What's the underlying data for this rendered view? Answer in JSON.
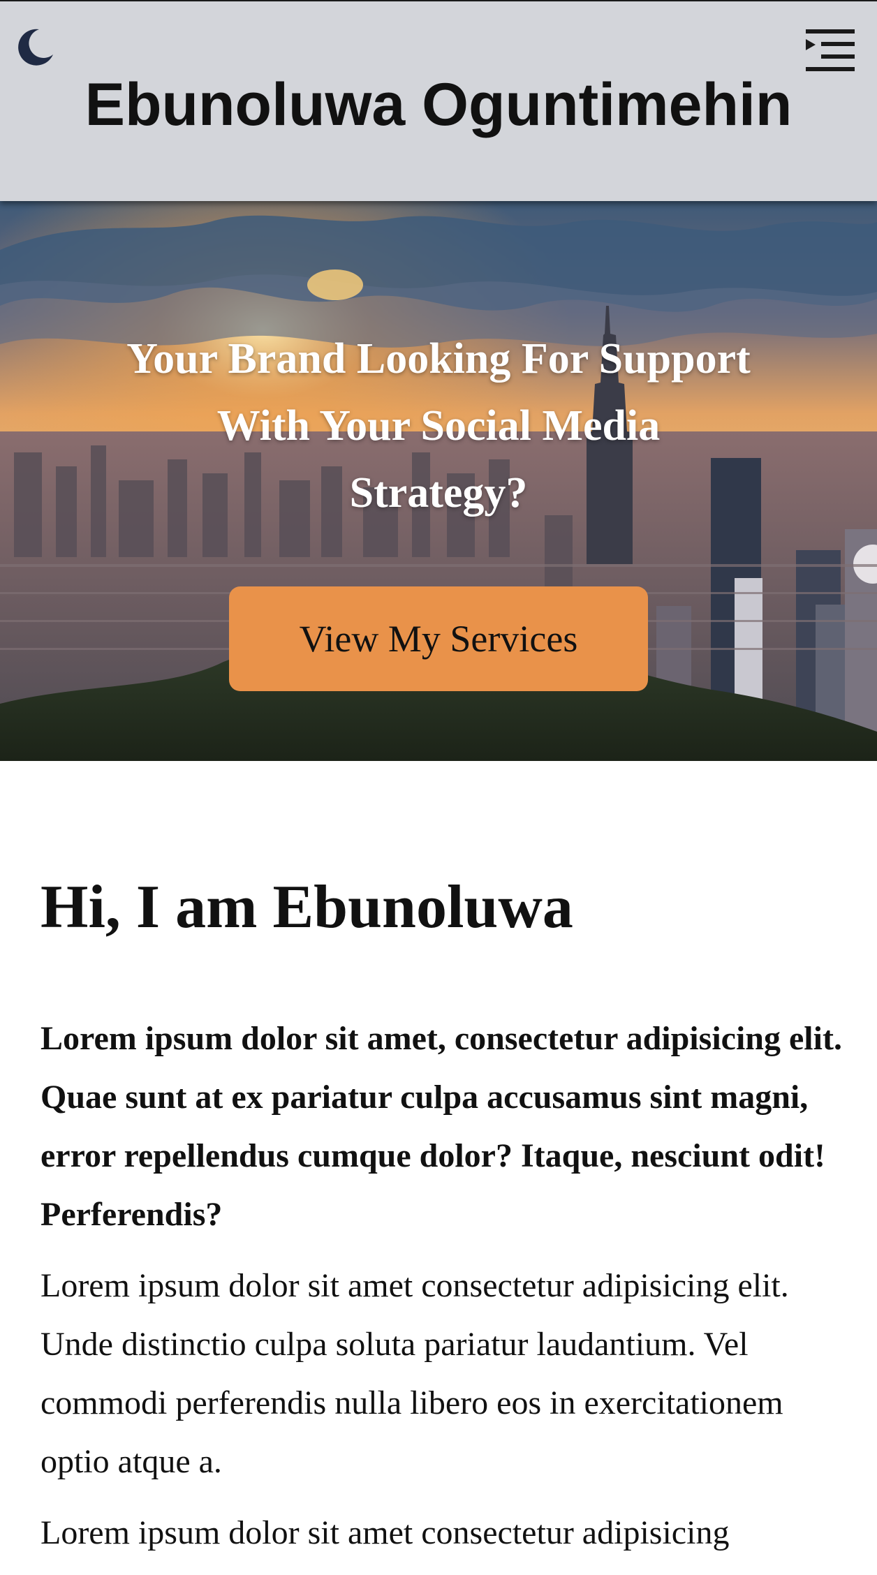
{
  "header": {
    "theme_toggle_icon": "moon-icon",
    "menu_icon": "menu-indent-icon",
    "site_title": "Ebunoluwa Oguntimehin"
  },
  "hero": {
    "heading": "Your Brand Looking For Support With Your Social Media Strategy?",
    "cta_label": "View My Services",
    "cta_color": "#e9924a"
  },
  "about": {
    "heading": "Hi, I am Ebunoluwa",
    "lead": "Lorem ipsum dolor sit amet, consectetur adipisicing elit. Quae sunt at ex pariatur culpa accusamus sint magni, error repellendus cumque dolor? Itaque, nesciunt odit! Perferendis?",
    "paragraph_1": "Lorem ipsum dolor sit amet consectetur adipisicing elit. Unde distinctio culpa soluta pariatur laudantium. Vel commodi perferendis nulla libero eos in exercitationem optio atque a.",
    "paragraph_2": "Lorem ipsum dolor sit amet consectetur adipisicing"
  },
  "colors": {
    "header_bg": "#d3d5da",
    "accent": "#e9924a"
  }
}
